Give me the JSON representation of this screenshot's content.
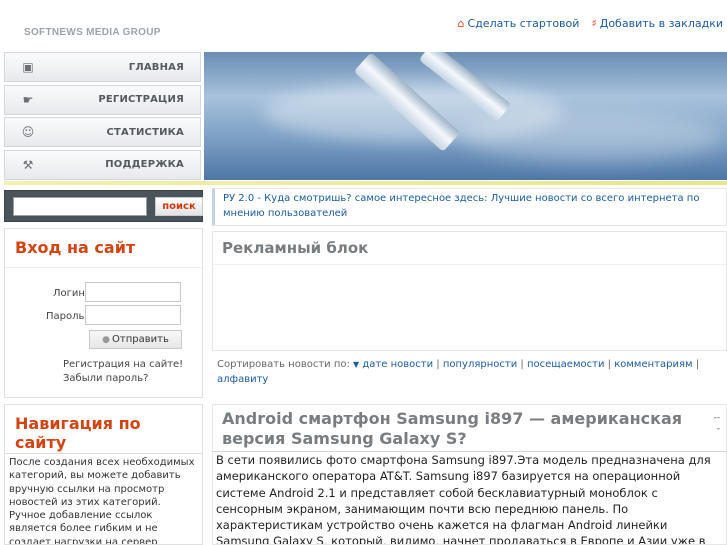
{
  "header": {
    "brand": "SOFTNEWS MEDIA GROUP",
    "make_home_label": "Сделать стартовой",
    "bookmark_label": "Добавить в закладки"
  },
  "menu": {
    "items": [
      {
        "label": "ГЛАВНАЯ",
        "icon": "home-icon"
      },
      {
        "label": "РЕГИСТРАЦИЯ",
        "icon": "register-icon"
      },
      {
        "label": "СТАТИСТИКА",
        "icon": "users-icon"
      },
      {
        "label": "ПОДДЕРЖКА",
        "icon": "tools-icon"
      }
    ]
  },
  "search": {
    "placeholder": "",
    "button_label": "поиск"
  },
  "login": {
    "title": "Вход на сайт",
    "login_label": "Логин",
    "password_label": "Пароль",
    "submit_label": "Отправить",
    "register_link": "Регистрация на сайте!",
    "forgot_link": "Забыли пароль?"
  },
  "navigation": {
    "title": "Навигация по сайту",
    "text": "После создания всех необходимых категорий, вы можете добавить вручную ссылки на просмотр новостей из этих категорий. Ручное добавление ссылок является более гибким и не создает нагрузки на сервер"
  },
  "ticker": {
    "text": "РУ 2.0 - Куда смотришь? самое интересное здесь: Лучшие новости со всего интернета по мнению пользователей"
  },
  "ad_block": {
    "title": "Рекламный блок"
  },
  "sort": {
    "prefix": "Сортировать новости по:",
    "options": [
      "дате новости",
      "популярности",
      "посещаемости",
      "комментариям",
      "алфавиту"
    ]
  },
  "article": {
    "title": "Android смартфон Samsung i897 — американская версия Samsung Galaxy S?",
    "dash_top": "--",
    "dash_bottom": "-",
    "body": "В сети появились фото смартфона  Samsung  i897.Эта модель предназначена для американского оператора    AT&T.    Samsung  i897 базируется на операционной системе  Android  2.1 и представляет собой бесклавиатурный моноблок с сенсорным экраном, занимающим почти всю переднюю панель. По характеристикам устройство очень кажется на флагман  Android линейки Samsung Galaxy S, который, видимо, начнет продаваться в Европе и Азии уже в"
  },
  "colors": {
    "accent_orange": "#d24412",
    "link_blue": "#1a5b9c",
    "search_bg": "#4b535b"
  }
}
